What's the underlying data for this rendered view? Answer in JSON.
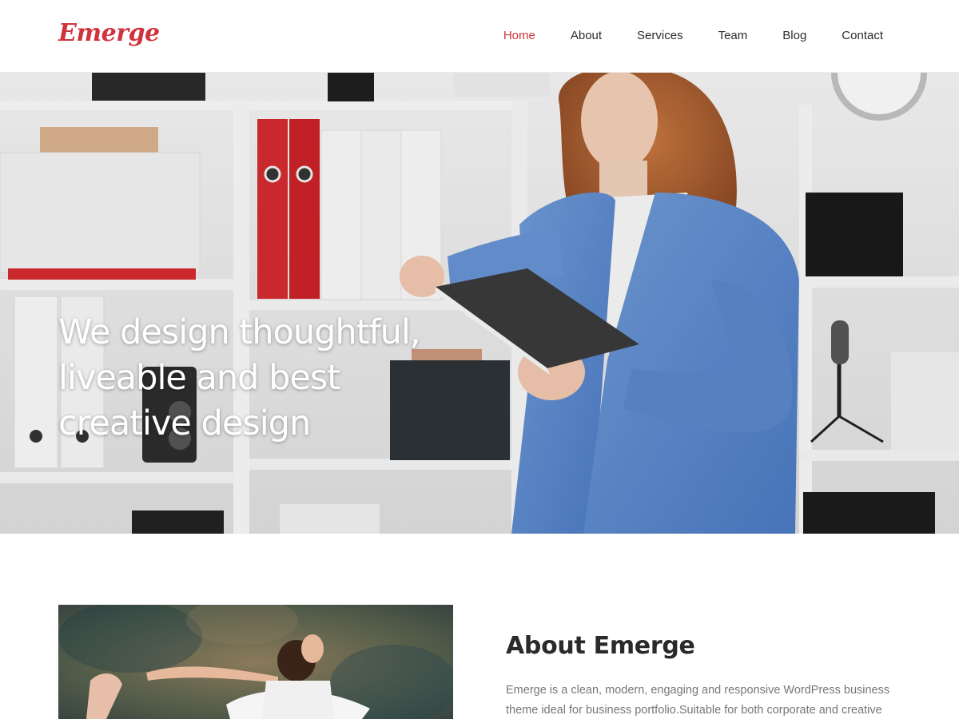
{
  "site": {
    "logo": "Emerge",
    "accent_color": "#d0333b"
  },
  "nav": {
    "items": [
      {
        "label": "Home",
        "active": true
      },
      {
        "label": "About",
        "active": false
      },
      {
        "label": "Services",
        "active": false
      },
      {
        "label": "Team",
        "active": false
      },
      {
        "label": "Blog",
        "active": false
      },
      {
        "label": "Contact",
        "active": false
      }
    ]
  },
  "hero": {
    "title_line_1": "We design thoughtful,",
    "title_line_2": "liveable and best",
    "title_line_3": "creative design"
  },
  "about": {
    "title": "About Emerge",
    "text": "Emerge is a clean, modern, engaging and responsive WordPress business theme ideal for business portfolio.Suitable for both corporate and creative"
  }
}
